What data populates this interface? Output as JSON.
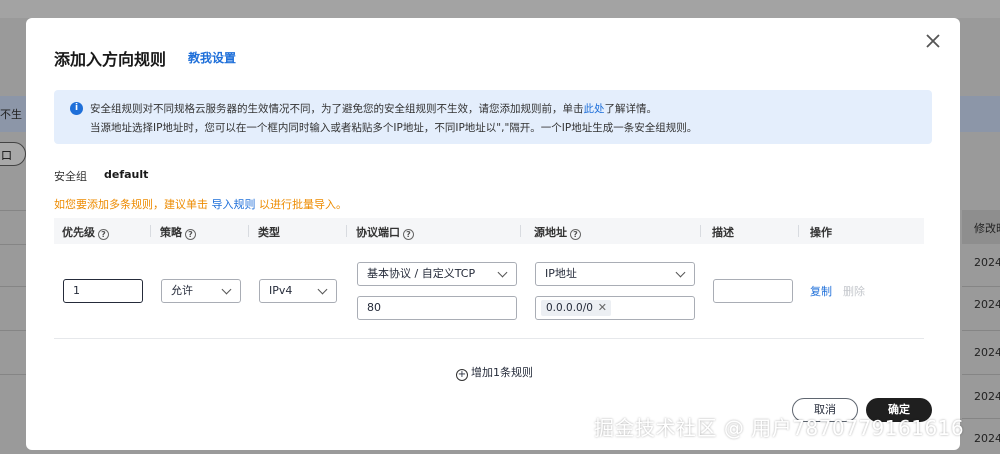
{
  "background": {
    "left_text": "不生",
    "left_button_label": "口",
    "right_header": "修改时",
    "right_cells": [
      "2024",
      "2024",
      "2024",
      "2024",
      "2024"
    ]
  },
  "dialog": {
    "title": "添加入方向规则",
    "guide_link": "教我设置",
    "notice": {
      "line1_before": "安全组规则对不同规格云服务器的生效情况不同，为了避免您的安全组规则不生效，请您添加规则前，单击",
      "line1_link": "此处",
      "line1_after": "了解详情。",
      "line2": "当源地址选择IP地址时，您可以在一个框内同时输入或者粘贴多个IP地址，不同IP地址以\",\"隔开。一个IP地址生成一条安全组规则。"
    },
    "security_group": {
      "label": "安全组",
      "value": "default"
    },
    "tip": {
      "before": "如您要添加多条规则，建议单击 ",
      "link": "导入规则",
      "after": " 以进行批量导入。"
    },
    "columns": {
      "priority": "优先级",
      "action": "策略",
      "type": "类型",
      "protocol_port": "协议端口",
      "source": "源地址",
      "description": "描述",
      "operation": "操作"
    },
    "rule": {
      "priority": "1",
      "action": "允许",
      "type": "IPv4",
      "protocol": "基本协议 / 自定义TCP",
      "port": "80",
      "source_type": "IP地址",
      "source_tag": "0.0.0.0/0",
      "description": "",
      "copy": "复制",
      "delete": "删除"
    },
    "add_rule": "增加1条规则",
    "cancel": "取消",
    "confirm": "确定"
  },
  "watermark": "掘金技术社区 @ 用户7870779161616",
  "colors": {
    "accent": "#1e6fd9",
    "warning": "#ed8b00",
    "primary_button": "#1f1f1f",
    "notice_bg": "#e4eefc"
  }
}
